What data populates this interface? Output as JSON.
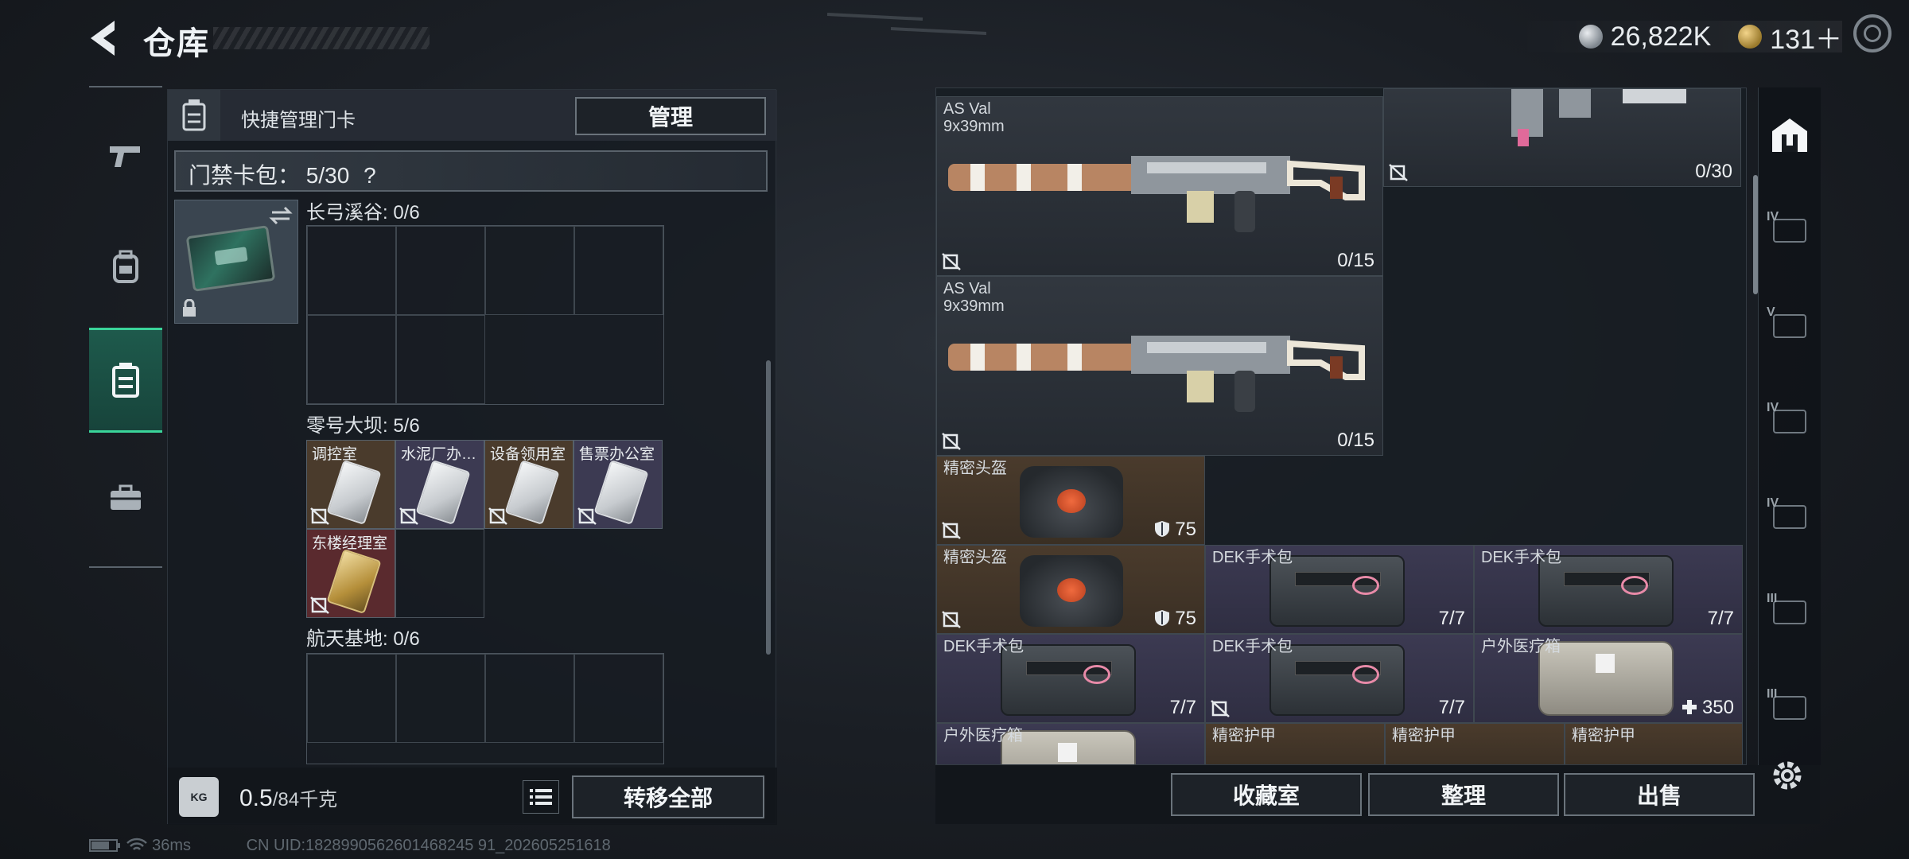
{
  "header": {
    "title": "仓库"
  },
  "currency": {
    "silver": "26,822K",
    "gold": "131＋"
  },
  "left_panel": {
    "quick_label": "快捷管理门卡",
    "manage_label": "管理",
    "cardpack_label": "门禁卡包：",
    "cardpack_count": "5/30",
    "cardpack_help": "?",
    "zones": [
      {
        "label": "长弓溪谷: 0/6"
      },
      {
        "label": "零号大坝: 5/6",
        "cards": [
          "调控室",
          "水泥厂办…",
          "设备领用室",
          "售票办公室",
          "东楼经理室"
        ]
      },
      {
        "label": "航天基地: 0/6"
      }
    ],
    "weight_value": "0.5",
    "weight_unit": "/84千克",
    "transfer_label": "转移全部"
  },
  "inventory": {
    "items": [
      {
        "name": "AS Val\n9x39mm",
        "qty": "0/15"
      },
      {
        "name": "",
        "qty": "0/30"
      },
      {
        "name": "AS Val\n9x39mm",
        "qty": "0/15"
      },
      {
        "name": "精密头盔",
        "qty": "75"
      },
      {
        "name": "精密头盔",
        "qty": "75"
      },
      {
        "name": "DEK手术包",
        "qty": "7/7"
      },
      {
        "name": "DEK手术包",
        "qty": "7/7"
      },
      {
        "name": "DEK手术包",
        "qty": "7/7"
      },
      {
        "name": "DEK手术包",
        "qty": "7/7"
      },
      {
        "name": "户外医疗箱",
        "qty": "350"
      },
      {
        "name": "户外医疗箱",
        "qty": ""
      },
      {
        "name": "精密护甲",
        "qty": ""
      },
      {
        "name": "精密护甲",
        "qty": ""
      },
      {
        "name": "精密护甲",
        "qty": ""
      }
    ],
    "buttons": {
      "collection": "收藏室",
      "sort": "整理",
      "sell": "出售"
    }
  },
  "right_tabs": [
    "IV",
    "V",
    "IV",
    "IV",
    "III",
    "III"
  ],
  "status": {
    "ping": "36ms",
    "uid": "CN UID:1828990562601468245 91_202605251618"
  },
  "colors": {
    "accent_green": "#3ad49a",
    "rarity_orange": "#4a3b2c",
    "rarity_purple": "#3c3a52"
  },
  "icons": [
    "back-arrow-icon",
    "silver-coin-icon",
    "gold-coin-icon",
    "settings-ring-icon",
    "pistol-icon",
    "backpack-icon",
    "keycard-holder-icon",
    "toolbox-icon",
    "swap-icon",
    "lock-icon",
    "no-sell-icon",
    "shield-icon",
    "plus-icon",
    "weight-icon",
    "list-icon",
    "home-base-icon",
    "gear-icon",
    "battery-icon",
    "wifi-icon"
  ]
}
